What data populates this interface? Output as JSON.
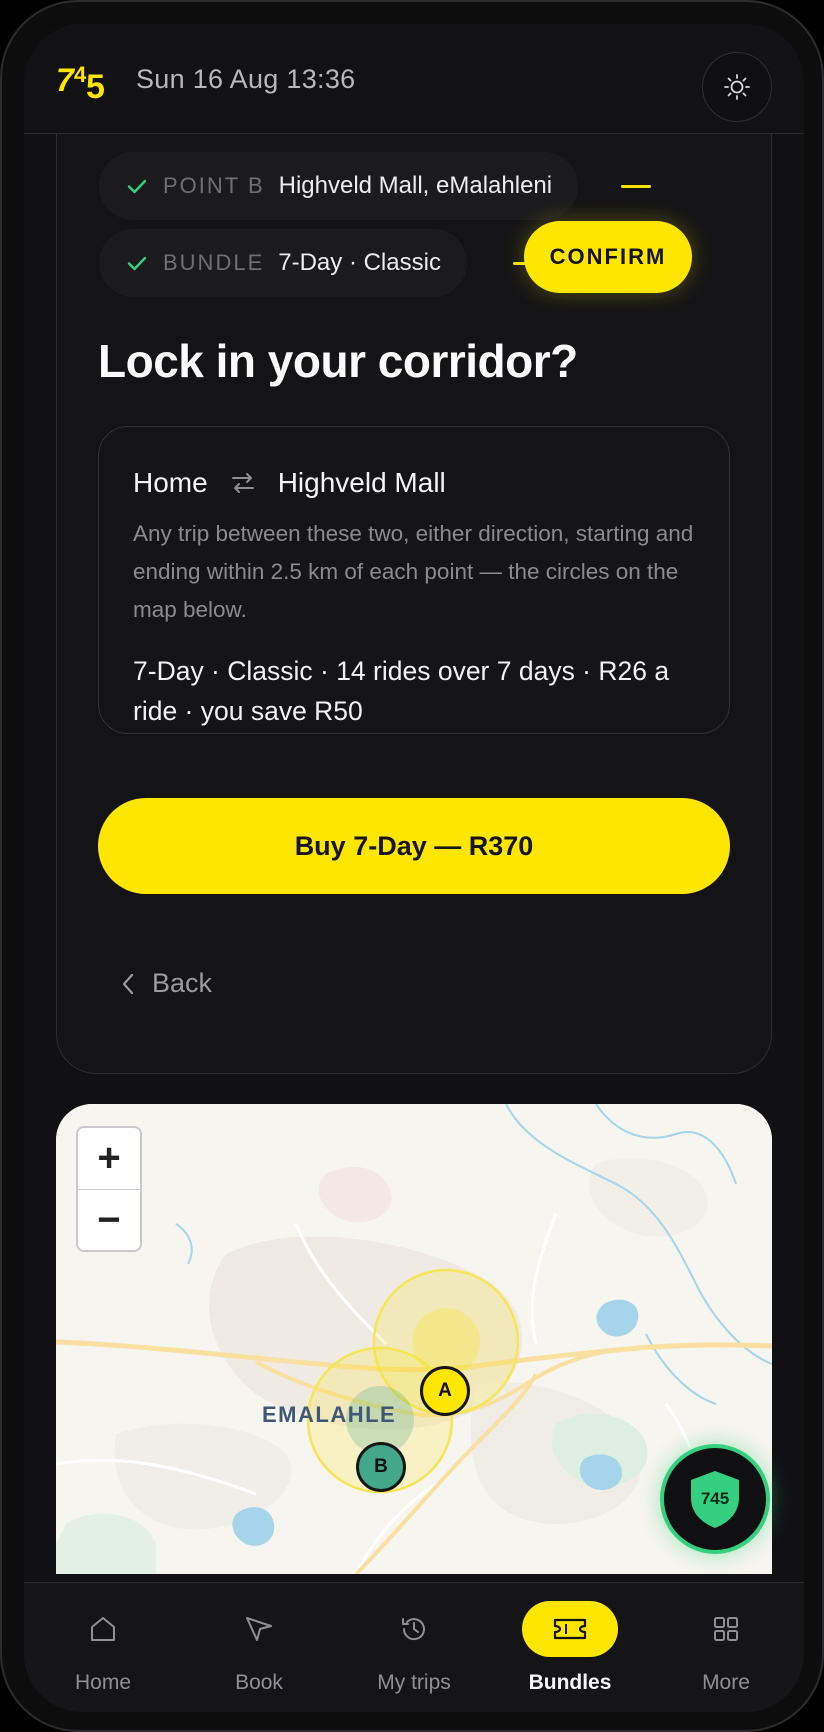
{
  "header": {
    "datetime": "Sun 16 Aug 13:36"
  },
  "steps": [
    {
      "label": "POINT B",
      "value": "Highveld Mall, eMalahleni"
    },
    {
      "label": "BUNDLE",
      "value": "7-Day · Classic"
    }
  ],
  "confirm_label": "CONFIRM",
  "title": "Lock in your corridor?",
  "corridor": {
    "from": "Home",
    "to": "Highveld Mall",
    "description": "Any trip between these two, either direction, starting and ending within 2.5 km of each point — the circles on the map below.",
    "summary": "7-Day · Classic · 14 rides over 7 days · R26 a ride · you save R50"
  },
  "buy_label": "Buy 7-Day — R370",
  "back_label": "Back",
  "map": {
    "zoom_in": "+",
    "zoom_out": "−",
    "city_label": "EMALAHLE",
    "pin_a": "A",
    "pin_b": "B"
  },
  "safety_badge": "745",
  "nav": [
    {
      "label": "Home",
      "icon": "home-icon"
    },
    {
      "label": "Book",
      "icon": "navigation-arrow-icon"
    },
    {
      "label": "My trips",
      "icon": "history-icon"
    },
    {
      "label": "Bundles",
      "icon": "ticket-icon",
      "active": true
    },
    {
      "label": "More",
      "icon": "grid-icon"
    }
  ],
  "colors": {
    "accent": "#ffe600",
    "success": "#35d07f",
    "pin_b": "#43a88a",
    "background": "#111113"
  }
}
